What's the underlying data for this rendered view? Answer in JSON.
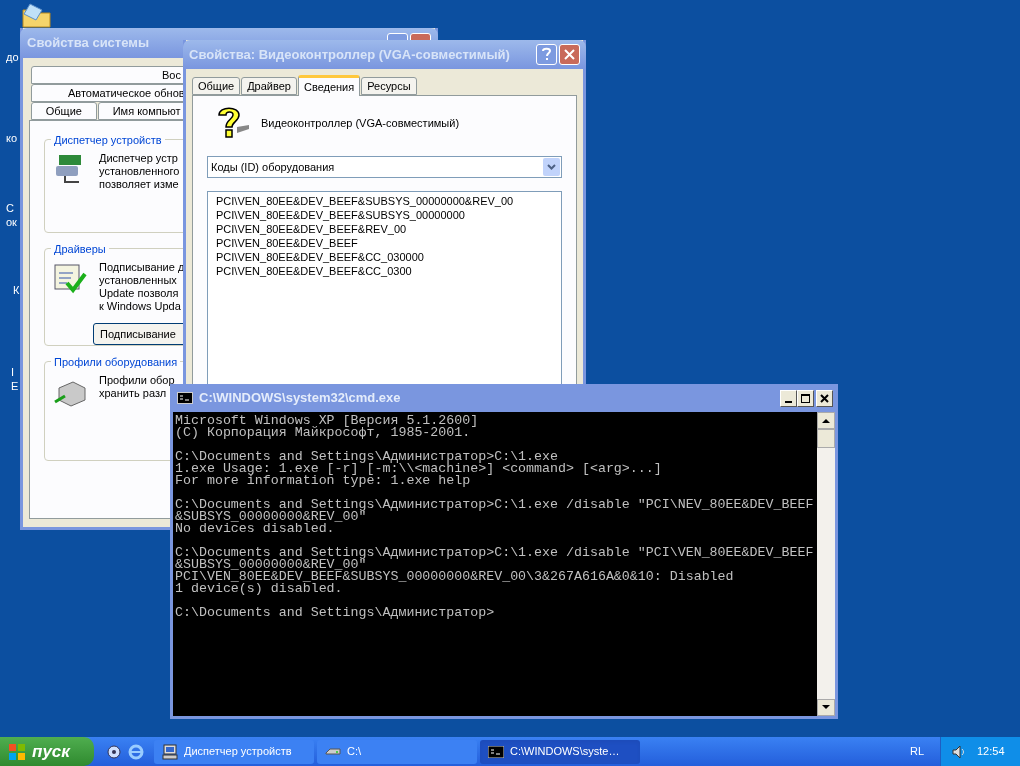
{
  "desktop_icons": [
    {
      "lines": [
        "до"
      ]
    },
    {
      "lines": [
        "ко"
      ]
    },
    {
      "lines": [
        "С",
        "ок"
      ]
    },
    {
      "lines": [
        "К"
      ]
    },
    {
      "lines": [
        "I",
        "E"
      ]
    }
  ],
  "system_properties": {
    "title": "Свойства системы",
    "tab_rows": [
      [
        "Вос"
      ],
      [
        "Автоматическое обнов"
      ],
      [
        "Общие",
        "Имя компьют"
      ]
    ],
    "groups": [
      {
        "title": "Диспетчер устройств",
        "kind": "text",
        "lines": [
          "Диспетчер устр",
          "установленного",
          "позволяет изме"
        ]
      },
      {
        "title": "Драйверы",
        "kind": "button",
        "lines": [
          "Подписывание д",
          "установленных",
          "Update позволя",
          "к Windows Upda"
        ],
        "button": "Подписывание"
      },
      {
        "title": "Профили оборудования",
        "kind": "text",
        "lines": [
          "Профили обор",
          "хранить разл"
        ]
      }
    ]
  },
  "video_properties": {
    "title": "Свойства: Видеоконтроллер (VGA-совместимый)",
    "tabs": [
      {
        "label": "Общие",
        "selected": false
      },
      {
        "label": "Драйвер",
        "selected": false
      },
      {
        "label": "Сведения",
        "selected": true
      },
      {
        "label": "Ресурсы",
        "selected": false
      }
    ],
    "device_name": "Видеоконтроллер (VGA-совместимый)",
    "dropdown": {
      "value": "Коды (ID) оборудования"
    },
    "list": [
      "PCI\\VEN_80EE&DEV_BEEF&SUBSYS_00000000&REV_00",
      "PCI\\VEN_80EE&DEV_BEEF&SUBSYS_00000000",
      "PCI\\VEN_80EE&DEV_BEEF&REV_00",
      "PCI\\VEN_80EE&DEV_BEEF",
      "PCI\\VEN_80EE&DEV_BEEF&CC_030000",
      "PCI\\VEN_80EE&DEV_BEEF&CC_0300"
    ]
  },
  "cmd": {
    "title": "C:\\WINDOWS\\system32\\cmd.exe",
    "blocks": [
      [
        "Microsoft Windows XP [Версия 5.1.2600]",
        "(С) Корпорация Майкрософт, 1985-2001."
      ],
      [
        "C:\\Documents and Settings\\Администратор>C:\\1.exe",
        "1.exe Usage: 1.exe [-r] [-m:\\\\<machine>] <command> [<arg>...]",
        "For more information type: 1.exe help"
      ],
      [
        "C:\\Documents and Settings\\Администратор>C:\\1.exe /disable \"PCI\\NEV_80EE&DEV_BEEF",
        "&SUBSYS_00000000&REV_00\"",
        "No devices disabled."
      ],
      [
        "C:\\Documents and Settings\\Администратор>C:\\1.exe /disable \"PCI\\VEN_80EE&DEV_BEEF",
        "&SUBSYS_00000000&REV_00\"",
        "PCI\\VEN_80EE&DEV_BEEF&SUBSYS_00000000&REV_00\\3&267A616A&0&10: Disabled",
        "1 device(s) disabled."
      ],
      [
        "C:\\Documents and Settings\\Администратор>"
      ]
    ]
  },
  "taskbar": {
    "start": "пуск",
    "tasks": [
      {
        "label": "Диспетчер устройств",
        "kind": "devmgr",
        "selected": false
      },
      {
        "label": "C:\\",
        "kind": "drive",
        "selected": false
      },
      {
        "label": "C:\\WINDOWS\\syste…",
        "kind": "console",
        "selected": true
      }
    ],
    "language": "RL",
    "time": "12:54"
  }
}
